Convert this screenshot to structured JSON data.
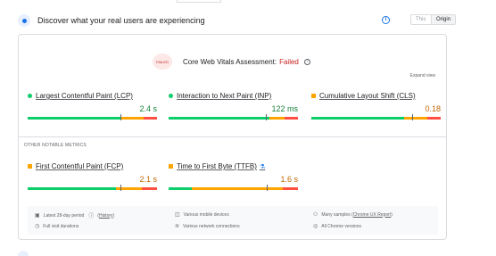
{
  "header": {
    "title": "Discover what your real users are experiencing",
    "toggle": {
      "this_url": "This URL",
      "origin": "Origin"
    }
  },
  "assessment": {
    "icon_label": "FAILED",
    "label": "Core Web Vitals Assessment:",
    "status": "Failed",
    "expand": "Expand view"
  },
  "metrics": [
    {
      "name": "Largest Contentful Paint (LCP)",
      "value": "2.4 s",
      "value_color": "#188038",
      "indicator": "dot",
      "indicator_color": "#0cce6b",
      "distribution": [
        0.72,
        0.18,
        0.1
      ],
      "marker": 0.72
    },
    {
      "name": "Interaction to Next Paint (INP)",
      "value": "122 ms",
      "value_color": "#188038",
      "indicator": "dot",
      "indicator_color": "#0cce6b",
      "distribution": [
        0.78,
        0.12,
        0.1
      ],
      "marker": 0.75
    },
    {
      "name": "Cumulative Layout Shift (CLS)",
      "value": "0.18",
      "value_color": "#c26401",
      "indicator": "square",
      "indicator_color": "#ffa400",
      "distribution": [
        0.72,
        0.18,
        0.1
      ],
      "marker": 0.78
    }
  ],
  "other_label": "OTHER NOTABLE METRICS",
  "other_metrics": [
    {
      "name": "First Contentful Paint (FCP)",
      "value": "2.1 s",
      "value_color": "#c26401",
      "indicator": "square",
      "indicator_color": "#ffa400",
      "distribution": [
        0.68,
        0.2,
        0.12
      ],
      "marker": 0.72
    },
    {
      "name": "Time to First Byte (TTFB)",
      "value": "1.6 s",
      "value_color": "#c26401",
      "indicator": "square",
      "indicator_color": "#ffa400",
      "distribution": [
        0.18,
        0.7,
        0.12
      ],
      "marker": 0.76
    }
  ],
  "colors": {
    "good": "#0cce6b",
    "needs_improvement": "#ffa400",
    "poor": "#ff4e42",
    "accent": "#1a73e8"
  },
  "footer": {
    "period": "Latest 28-day period",
    "history": "History",
    "devices": "Various mobile devices",
    "samples_prefix": "Many samples",
    "samples_link": "Chrome UX Report",
    "durations": "Full visit durations",
    "network": "Various network connections",
    "versions": "All Chrome versions"
  }
}
